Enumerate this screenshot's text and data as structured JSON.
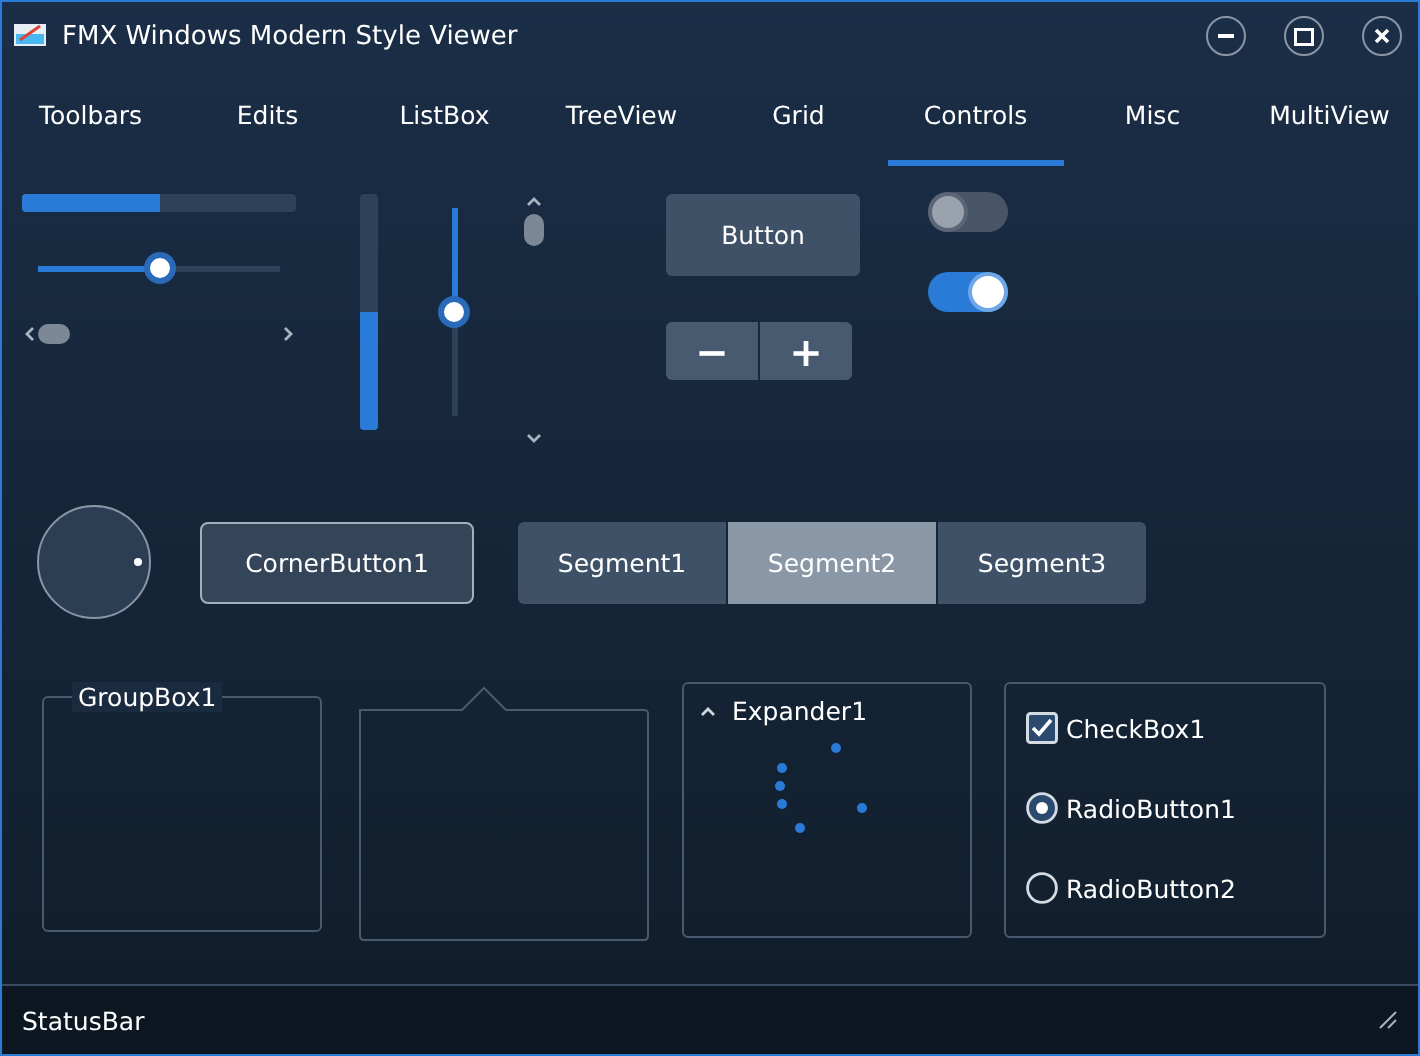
{
  "window": {
    "title": "FMX Windows Modern Style Viewer"
  },
  "tabs": [
    {
      "label": "Toolbars",
      "selected": false
    },
    {
      "label": "Edits",
      "selected": false
    },
    {
      "label": "ListBox",
      "selected": false
    },
    {
      "label": "TreeView",
      "selected": false
    },
    {
      "label": "Grid",
      "selected": false
    },
    {
      "label": "Controls",
      "selected": true
    },
    {
      "label": "Misc",
      "selected": false
    },
    {
      "label": "MultiView",
      "selected": false
    }
  ],
  "progress_bar": {
    "level": 0.5
  },
  "slider": {
    "level": 0.5
  },
  "vertical_progress_bar": {
    "level": 0.5
  },
  "vertical_slider": {
    "level": 0.5
  },
  "button": {
    "label": "Button"
  },
  "spin_buttons": [
    "−",
    "+"
  ],
  "switches": [
    {
      "on": false
    },
    {
      "on": true
    }
  ],
  "corner_button": {
    "label": "CornerButton1"
  },
  "segments": [
    {
      "label": "Segment1",
      "selected": false
    },
    {
      "label": "Segment2",
      "selected": true
    },
    {
      "label": "Segment3",
      "selected": false
    }
  ],
  "group_box": {
    "title": "GroupBox1"
  },
  "expander": {
    "title": "Expander1",
    "expanded": true
  },
  "checkbox": {
    "label": "CheckBox1",
    "checked": true
  },
  "radios": [
    {
      "label": "RadioButton1",
      "selected": true
    },
    {
      "label": "RadioButton2",
      "selected": false
    }
  ],
  "status_bar": {
    "text": "StatusBar"
  }
}
